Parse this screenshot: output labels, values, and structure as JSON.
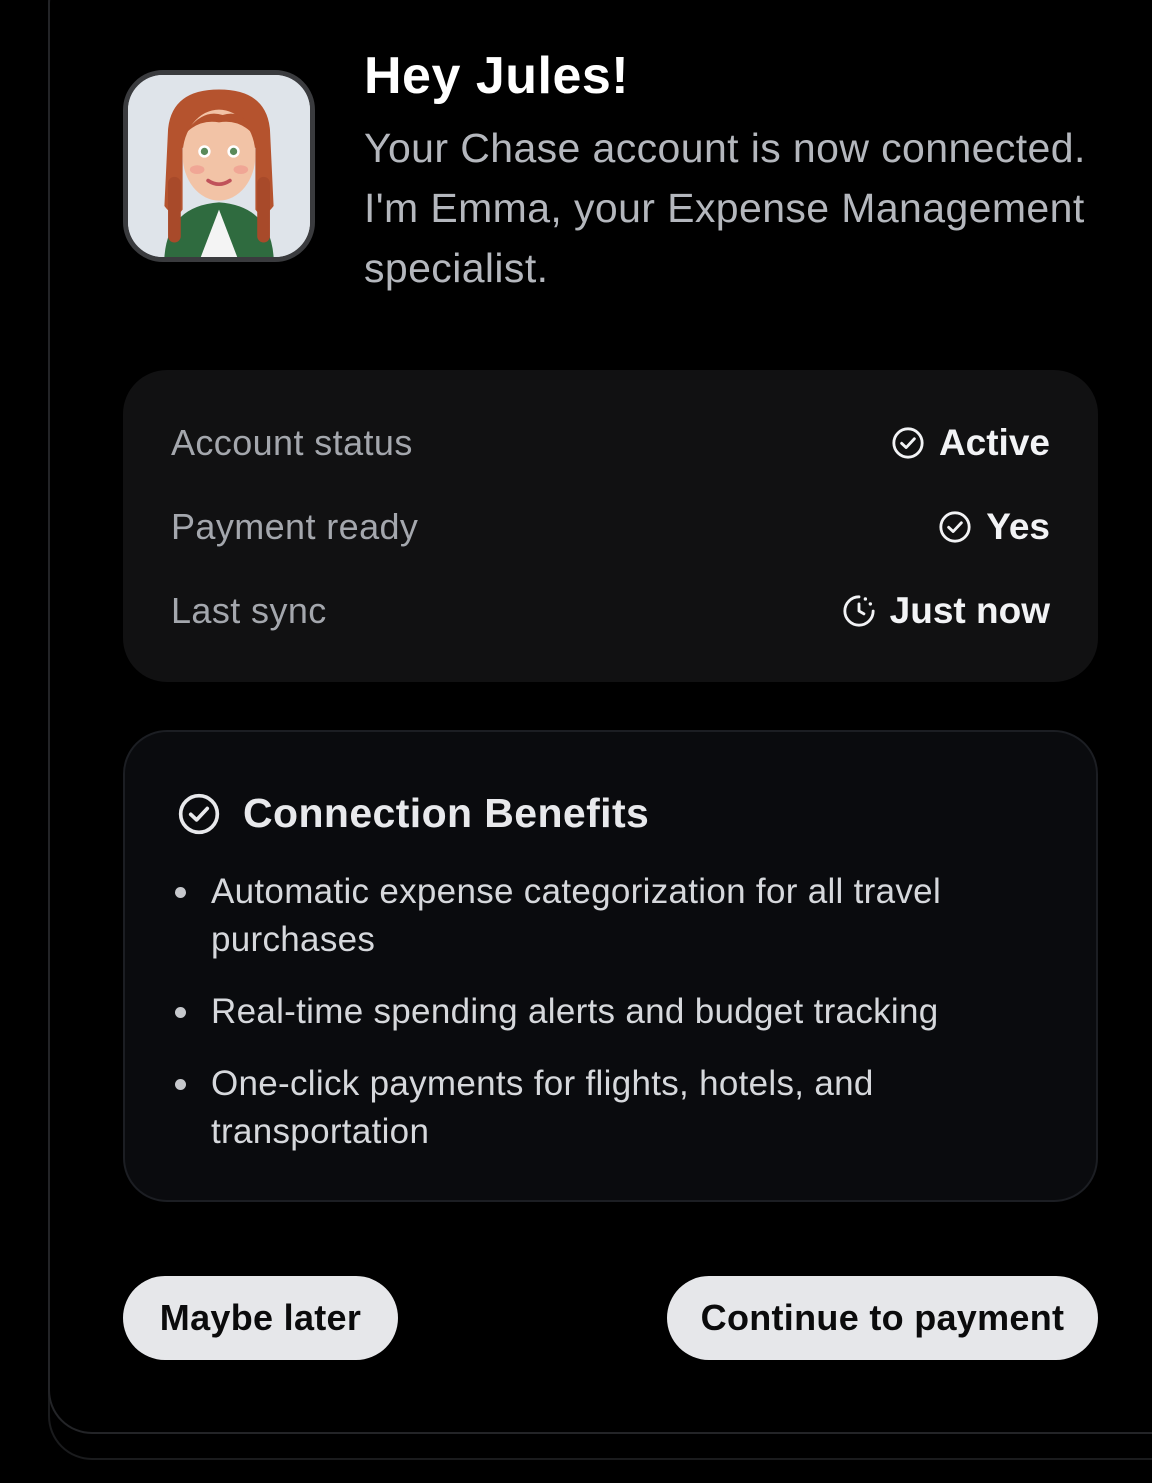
{
  "header": {
    "greeting": "Hey Jules!",
    "intro": "Your Chase account is now connected. I'm Emma, your Expense Management specialist."
  },
  "avatar": {
    "icon": "assistant-avatar-emma"
  },
  "status": {
    "rows": [
      {
        "label": "Account status",
        "value": "Active",
        "icon": "check-circle-icon"
      },
      {
        "label": "Payment ready",
        "value": "Yes",
        "icon": "check-circle-icon"
      },
      {
        "label": "Last sync",
        "value": "Just now",
        "icon": "clock-sync-icon"
      }
    ]
  },
  "benefits": {
    "title": "Connection Benefits",
    "icon": "check-circle-icon",
    "items": [
      "Automatic expense categorization for all travel purchases",
      "Real-time spending alerts and budget tracking",
      "One-click payments for flights, hotels, and transportation"
    ]
  },
  "actions": {
    "secondary_label": "Maybe later",
    "primary_label": "Continue to payment"
  },
  "colors": {
    "background": "#000000",
    "panel": "#111112",
    "button_bg": "#e6e7ea",
    "muted_text": "#a4a7ad"
  }
}
